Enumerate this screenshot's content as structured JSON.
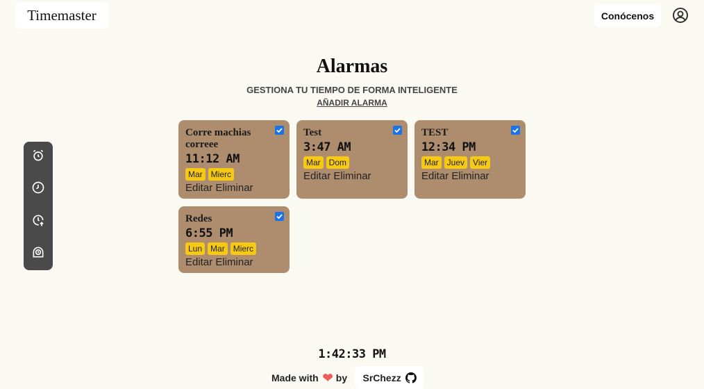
{
  "header": {
    "brand": "Timemaster",
    "about_label": "Conócenos"
  },
  "main": {
    "title": "Alarmas",
    "subtitle": "GESTIONA TU TIEMPO DE FORMA INTELIGENTE",
    "add_label": "AÑADIR ALARMA"
  },
  "sidebar": {
    "icons": [
      "alarm-icon",
      "clock-icon",
      "clock-arrow-up-icon",
      "timer-icon"
    ]
  },
  "alarms": [
    {
      "name": "Corre machias correee",
      "time": "11:12 AM",
      "days": [
        "Mar",
        "Mierc"
      ],
      "edit": "Editar",
      "delete": "Eliminar",
      "active": true
    },
    {
      "name": "Test",
      "time": "3:47 AM",
      "days": [
        "Mar",
        "Dom"
      ],
      "edit": "Editar",
      "delete": "Eliminar",
      "active": true
    },
    {
      "name": "TEST",
      "time": "12:34 PM",
      "days": [
        "Mar",
        "Juev",
        "Vier"
      ],
      "edit": "Editar",
      "delete": "Eliminar",
      "active": true
    },
    {
      "name": "Redes",
      "time": "6:55 PM",
      "days": [
        "Lun",
        "Mar",
        "Mierc"
      ],
      "edit": "Editar",
      "delete": "Eliminar",
      "active": true
    }
  ],
  "footer": {
    "clock": "1:42:33 PM",
    "made_with": "Made with by",
    "made_by": "by",
    "author": "SrChezz"
  },
  "colors": {
    "background": "#fafaf3",
    "card": "#ae8d6f",
    "day_badge": "#f6c915",
    "sidebar": "#4a4a4a",
    "heart": "#ef5b5b",
    "checkbox": "#1a73e8"
  }
}
